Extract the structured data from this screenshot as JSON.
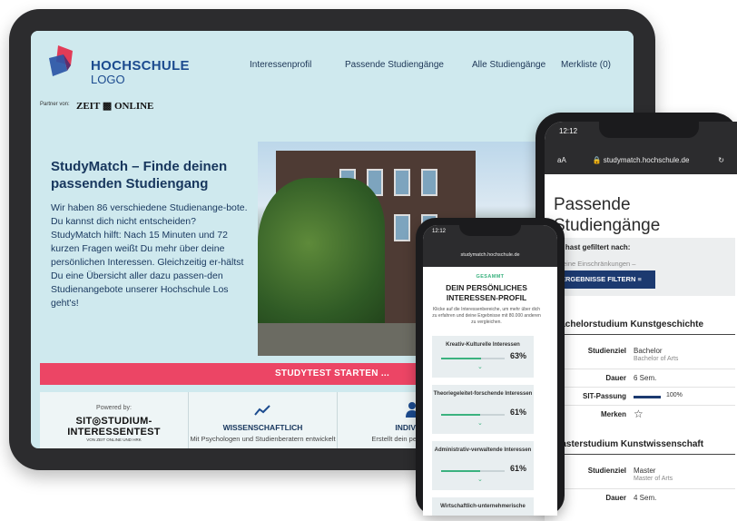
{
  "tablet": {
    "logo": {
      "line1": "HOCHSCHULE",
      "line2": "LOGO"
    },
    "nav": [
      "Interessenprofil",
      "Passende Studiengänge",
      "Alle Studiengänge",
      "Merkliste (0)"
    ],
    "partner_label": "Partner von:",
    "partner_brand": "ZEIT ▩ ONLINE",
    "hero_title": "StudyMatch – Finde deinen passenden Studiengang",
    "hero_body": "Wir haben 86 verschiedene Studienange-bote. Du kannst dich nicht entscheiden? StudyMatch hilft: Nach 15 Minuten und 72 kurzen Fragen weißt Du mehr über deine persönlichen Interessen. Gleichzeitig er-hältst Du eine Übersicht aller dazu passen-den Studienangebote unserer Hochschule Los geht's!",
    "cta": "STUDYTEST STARTEN ...",
    "features": {
      "powered_by": "Powered by:",
      "sit_name": "SIT◎STUDIUM-INTERESSENTEST",
      "sit_sub": "VON ZEIT ONLINE UND HRK",
      "f1_title": "WISSENSCHAFTLICH",
      "f1_text": "Mit Psychologen und Studienberatern entwickelt",
      "f2_title": "INDIVIDU",
      "f2_text": "Erstellt dein per Interessen"
    },
    "colors": {
      "accent": "#ec4565",
      "navy": "#17365d",
      "bg": "#cfe9ee"
    }
  },
  "phone_small": {
    "time": "12:12",
    "url": "studymatch.hochschule.de",
    "eyebrow": "GESAMMT",
    "title": "DEIN PERSÖNLICHES INTERESSEN-PROFIL",
    "intro": "Klicke auf die Interessenbereiche, um mehr über dich zu erfahren und deine Ergebnisse mit 80.000 anderen zu vergleichen.",
    "cards": [
      {
        "label": "Kreativ-Kulturelle Interessen",
        "percent": "63%",
        "value": 63
      },
      {
        "label": "Theoriegeleitet-forschende Interessen",
        "percent": "61%",
        "value": 61
      },
      {
        "label": "Administrativ-verwaltende Interessen",
        "percent": "61%",
        "value": 61
      },
      {
        "label": "Wirtschaftlich-unternehmerische",
        "percent": "",
        "value": 0
      }
    ]
  },
  "phone_big": {
    "time": "12:12",
    "url": "studymatch.hochschule.de",
    "aa": "aA",
    "title": "Passende Studiengänge",
    "filter_label": "Du hast gefiltert nach:",
    "filter_hint": "– keine Einschränkungen –",
    "filter_button": "ERGEBNISSE FILTERN",
    "program1": {
      "name": "Bachelorstudium Kunstgeschichte",
      "goal_label": "Studienziel",
      "goal": "Bachelor",
      "goal_sub": "Bachelor of Arts",
      "duration_label": "Dauer",
      "duration": "6 Sem.",
      "fit_label": "SIT-Passung",
      "fit": "100%",
      "fit_value": 100,
      "save_label": "Merken",
      "save_icon": "☆"
    },
    "program2": {
      "name": "Masterstudium Kunstwissenschaft",
      "goal_label": "Studienziel",
      "goal": "Master",
      "goal_sub": "Master of Arts",
      "duration_label": "Dauer",
      "duration": "4 Sem."
    }
  }
}
